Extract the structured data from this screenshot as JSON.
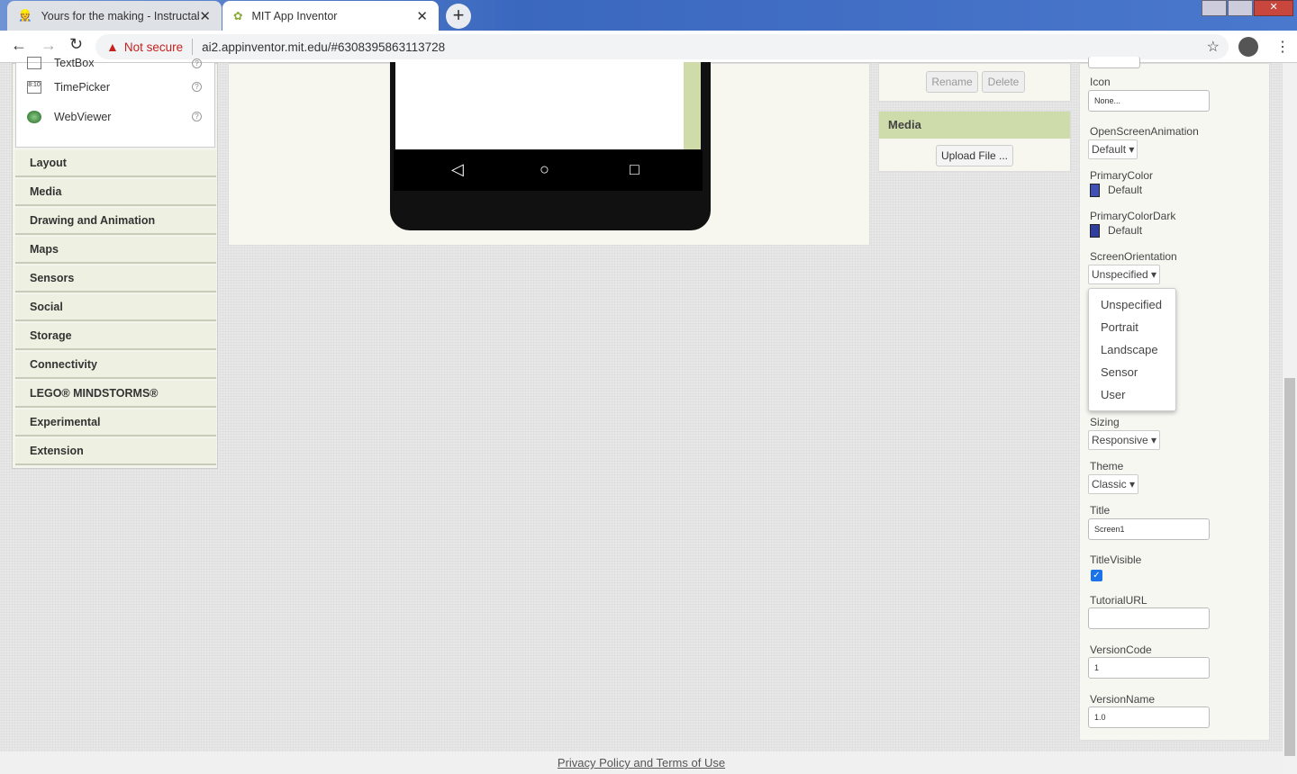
{
  "browser": {
    "tabs": [
      {
        "title": "Yours for the making - Instructab"
      },
      {
        "title": "MIT App Inventor"
      }
    ],
    "security": "Not secure",
    "url": "ai2.appinventor.mit.edu/#6308395863113728"
  },
  "palette": {
    "items": [
      {
        "label": "TextBox",
        "icon": "textbox-icon"
      },
      {
        "label": "TimePicker",
        "icon": "timepicker-icon"
      },
      {
        "label": "WebViewer",
        "icon": "globe-icon"
      }
    ],
    "categories": [
      "Layout",
      "Media",
      "Drawing and Animation",
      "Maps",
      "Sensors",
      "Social",
      "Storage",
      "Connectivity",
      "LEGO® MINDSTORMS®",
      "Experimental",
      "Extension"
    ]
  },
  "components": {
    "rename": "Rename",
    "delete": "Delete"
  },
  "media": {
    "header": "Media",
    "upload": "Upload File ..."
  },
  "properties": {
    "icon_label": "Icon",
    "icon_value": "None...",
    "osa_label": "OpenScreenAnimation",
    "osa_value": "Default",
    "pc_label": "PrimaryColor",
    "pc_value": "Default",
    "pc_color": "#3F51B5",
    "pcd_label": "PrimaryColorDark",
    "pcd_value": "Default",
    "pcd_color": "#303F9F",
    "so_label": "ScreenOrientation",
    "so_value": "Unspecified",
    "so_options": [
      "Unspecified",
      "Portrait",
      "Landscape",
      "Sensor",
      "User"
    ],
    "sizing_label": "Sizing",
    "sizing_value": "Responsive",
    "theme_label": "Theme",
    "theme_value": "Classic",
    "title_label": "Title",
    "title_value": "Screen1",
    "tv_label": "TitleVisible",
    "tv_checked": true,
    "turl_label": "TutorialURL",
    "turl_value": "",
    "vc_label": "VersionCode",
    "vc_value": "1",
    "vn_label": "VersionName",
    "vn_value": "1.0"
  },
  "footer": {
    "link": "Privacy Policy and Terms of Use"
  }
}
